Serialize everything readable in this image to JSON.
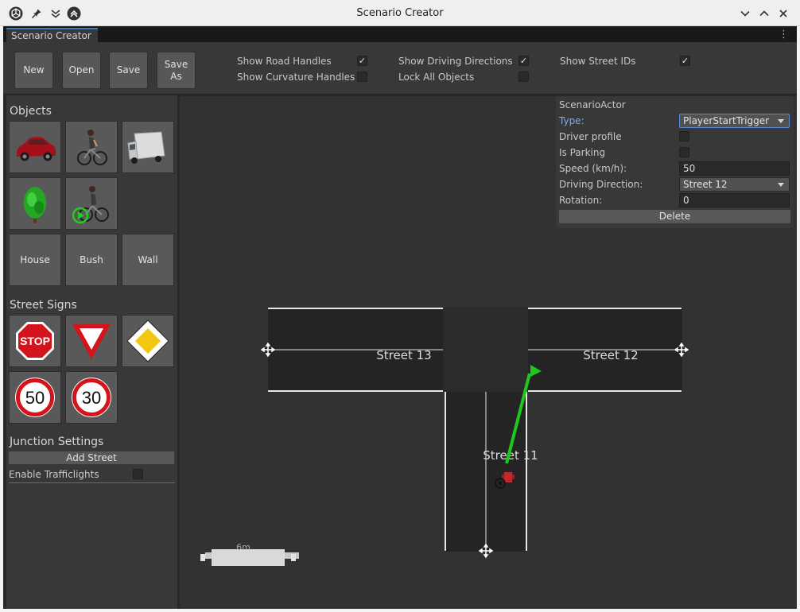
{
  "window": {
    "title": "Scenario Creator",
    "tab_label": "Scenario Creator",
    "menu_glyph": "⋮"
  },
  "toolbar": {
    "new_label": "New",
    "open_label": "Open",
    "save_label": "Save",
    "save_as_line1": "Save",
    "save_as_line2": "As",
    "toggles": {
      "show_road_handles": {
        "label": "Show Road Handles",
        "checked": true
      },
      "show_curvature_handles": {
        "label": "Show Curvature Handles",
        "checked": false
      },
      "show_driving_directions": {
        "label": "Show Driving Directions",
        "checked": true
      },
      "lock_all_objects": {
        "label": "Lock All Objects",
        "checked": false
      },
      "show_street_ids": {
        "label": "Show Street IDs",
        "checked": true
      }
    }
  },
  "objects": {
    "title": "Objects",
    "items": [
      "car",
      "cyclist",
      "truck",
      "tree",
      "cyclist-start"
    ],
    "text_items": [
      "House",
      "Bush",
      "Wall"
    ]
  },
  "signs": {
    "title": "Street Signs",
    "stop_text": "STOP",
    "speed_50": "50",
    "speed_30": "30"
  },
  "junction": {
    "title": "Junction Settings",
    "add_street_label": "Add Street",
    "enable_trafficlights_label": "Enable Trafficlights",
    "enable_trafficlights_checked": false
  },
  "inspector": {
    "header": "ScenarioActor",
    "type_label": "Type:",
    "type_value": "PlayerStartTrigger",
    "driver_profile_label": "Driver profile",
    "is_parking_label": "Is Parking",
    "speed_label": "Speed (km/h):",
    "speed_value": "50",
    "driving_direction_label": "Driving Direction:",
    "driving_direction_value": "Street 12",
    "rotation_label": "Rotation:",
    "rotation_value": "0",
    "delete_label": "Delete"
  },
  "scene": {
    "street_13_label": "Street 13",
    "street_12_label": "Street 12",
    "street_11_label": "Street 11",
    "scale_label": "6m",
    "colors": {
      "road": "#242424",
      "road_edge": "#e6e6e6",
      "direction_arrow": "#1ec81e",
      "actor": "#c0282d"
    }
  },
  "colors": {
    "accent": "#3a79bb",
    "panel": "#383838",
    "background": "#282828"
  }
}
